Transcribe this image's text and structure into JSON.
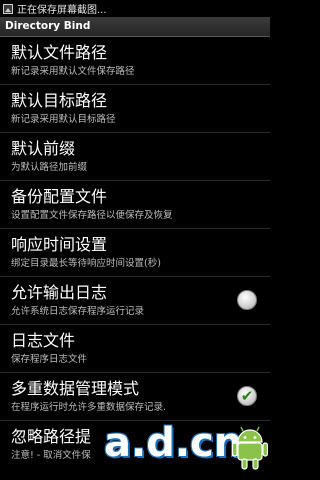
{
  "status_bar": {
    "text": "正在保存屏幕截图..."
  },
  "app": {
    "title": "Directory Bind"
  },
  "settings": [
    {
      "title": "默认文件路径",
      "summary": "新记录采用默认文件保存路径",
      "has_checkbox": false
    },
    {
      "title": "默认目标路径",
      "summary": "新记录采用默认目标路径",
      "has_checkbox": false
    },
    {
      "title": "默认前缀",
      "summary": "为默认路径加前缀",
      "has_checkbox": false
    },
    {
      "title": "备份配置文件",
      "summary": "设置配置文件保存路径以便保存及恢复",
      "has_checkbox": false
    },
    {
      "title": "响应时间设置",
      "summary": "绑定目录最长等待响应时间设置(秒)",
      "has_checkbox": false
    },
    {
      "title": "允许输出日志",
      "summary": "允许系统日志保存程序运行记录",
      "has_checkbox": true,
      "checked": false
    },
    {
      "title": "日志文件",
      "summary": "保存程序日志文件",
      "has_checkbox": false
    },
    {
      "title": "多重数据管理模式",
      "summary": "在程序运行时允许多重数据保存记录.",
      "has_checkbox": true,
      "checked": true
    },
    {
      "title": "忽略路径提",
      "summary": "注意! - 取消文件保",
      "has_checkbox": false
    }
  ],
  "watermark": {
    "text": "a.d.cn",
    "icon": "android-robot-icon",
    "colors": {
      "outline": "#1b6fb6",
      "robot": "#8bc34a"
    }
  },
  "colors": {
    "background": "#000000",
    "title_bar": "#2f2f2f",
    "summary_text": "#bdbdbd",
    "check_mark": "#2e7d1e"
  }
}
